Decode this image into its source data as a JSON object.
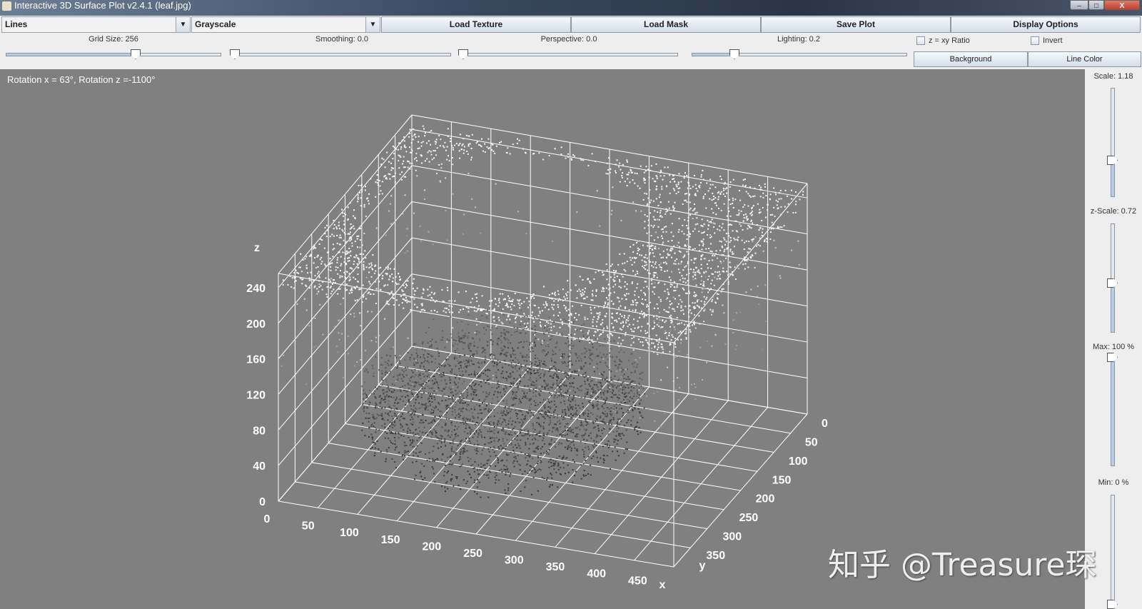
{
  "window": {
    "title": "Interactive 3D Surface Plot v2.4.1  (leaf.jpg)",
    "minimize": "–",
    "maximize": "□",
    "close": "X"
  },
  "toolbar": {
    "mode_select": "Lines",
    "colormap_select": "Grayscale",
    "buttons": [
      "Load Texture",
      "Load Mask",
      "Save Plot",
      "Display Options"
    ],
    "sliders": [
      {
        "label": "Grid Size: 256",
        "value": 0.6
      },
      {
        "label": "Smoothing: 0.0",
        "value": 0.0
      },
      {
        "label": "Perspective: 0.0",
        "value": 0.0
      },
      {
        "label": "Lighting: 0.2",
        "value": 0.2
      }
    ],
    "checkboxes": [
      {
        "label": "z = xy Ratio",
        "checked": false
      },
      {
        "label": "Invert",
        "checked": false
      }
    ],
    "background_button": "Background",
    "line_color_button": "Line Color"
  },
  "plot": {
    "rotation_text": "Rotation x = 63°, Rotation z =-1100°",
    "background_color": "#808080",
    "z_label": "z",
    "x_label": "x",
    "y_label": "y",
    "z_ticks": [
      "0",
      "40",
      "80",
      "120",
      "160",
      "200",
      "240"
    ],
    "x_ticks": [
      "0",
      "50",
      "100",
      "150",
      "200",
      "250",
      "300",
      "350",
      "400",
      "450"
    ],
    "y_ticks": [
      "0",
      "50",
      "100",
      "150",
      "200",
      "250",
      "300",
      "350"
    ]
  },
  "right_panel": [
    {
      "label": "Scale: 1.18",
      "value": 0.33
    },
    {
      "label": "z-Scale: 0.72",
      "value": 0.45
    },
    {
      "label": "Max: 100 %",
      "value": 1.0
    },
    {
      "label": "Min: 0 %",
      "value": 0.0
    }
  ],
  "watermark": "知乎 @Treasure琛"
}
